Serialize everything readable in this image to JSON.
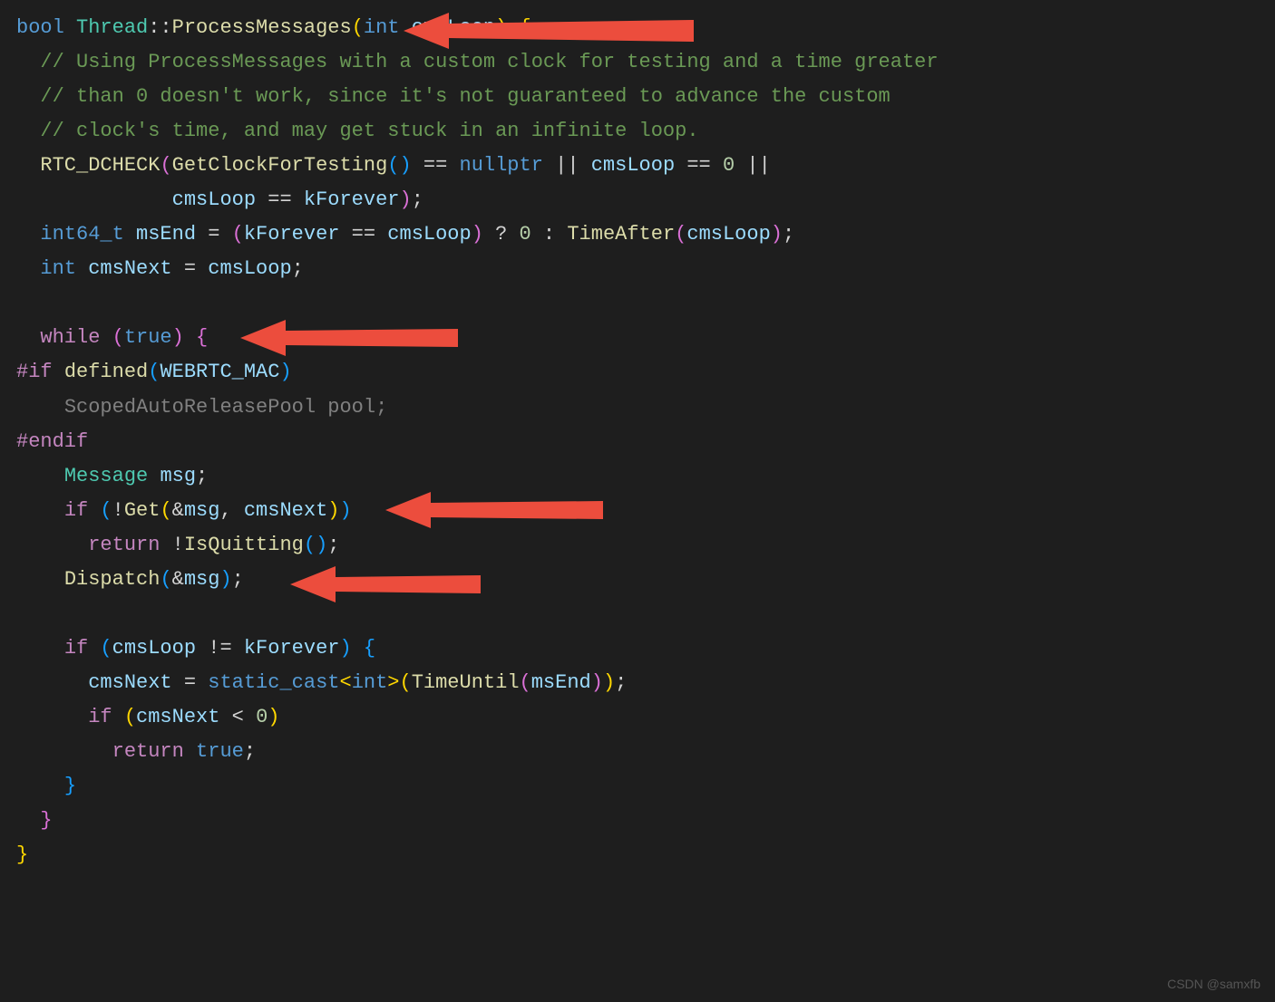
{
  "code": {
    "l1": {
      "t1": "bool",
      "t2": " ",
      "t3": "Thread",
      "t4": "::",
      "t5": "ProcessMessages",
      "t6": "(",
      "t7": "int",
      "t8": " cmsLoop",
      "t9": ")",
      "t10": " {",
      "t11": ""
    },
    "l2": {
      "t1": "  ",
      "t2": "// Using ProcessMessages with a custom clock for testing and a time greater"
    },
    "l3": {
      "t1": "  ",
      "t2": "// than 0 doesn't work, since it's not guaranteed to advance the custom"
    },
    "l4": {
      "t1": "  ",
      "t2": "// clock's time, and may get stuck in an infinite loop."
    },
    "l5": {
      "t1": "  ",
      "t2": "RTC_DCHECK",
      "t3": "(",
      "t4": "GetClockForTesting",
      "t5": "()",
      "t6": " == ",
      "t7": "nullptr",
      "t8": " || ",
      "t9": "cmsLoop",
      "t10": " == ",
      "t11": "0",
      "t12": " ||"
    },
    "l6": {
      "t1": "             ",
      "t2": "cmsLoop",
      "t3": " == ",
      "t4": "kForever",
      "t5": ")",
      "t6": ";"
    },
    "l7": {
      "t1": "  ",
      "t2": "int64_t",
      "t3": " ",
      "t4": "msEnd",
      "t5": " = ",
      "t6": "(",
      "t7": "kForever",
      "t8": " == ",
      "t9": "cmsLoop",
      "t10": ")",
      "t11": " ? ",
      "t12": "0",
      "t13": " : ",
      "t14": "TimeAfter",
      "t15": "(",
      "t16": "cmsLoop",
      "t17": ")",
      "t18": ";"
    },
    "l8": {
      "t1": "  ",
      "t2": "int",
      "t3": " ",
      "t4": "cmsNext",
      "t5": " = ",
      "t6": "cmsLoop",
      "t7": ";"
    },
    "l9": {
      "t1": " "
    },
    "l10": {
      "t1": "  ",
      "t2": "while",
      "t3": " ",
      "t4": "(",
      "t5": "true",
      "t6": ")",
      "t7": " ",
      "t8": "{"
    },
    "l11": {
      "t1": "#if",
      "t2": " ",
      "t3": "defined",
      "t4": "(",
      "t5": "WEBRTC_MAC",
      "t6": ")"
    },
    "l12": {
      "t1": "    ",
      "t2": "ScopedAutoReleasePool",
      "t3": " ",
      "t4": "pool",
      "t5": ";"
    },
    "l13": {
      "t1": "#endif"
    },
    "l14": {
      "t1": "    ",
      "t2": "Message",
      "t3": " ",
      "t4": "msg",
      "t5": ";"
    },
    "l15": {
      "t1": "    ",
      "t2": "if",
      "t3": " ",
      "t4": "(",
      "t5": "!",
      "t6": "Get",
      "t7": "(",
      "t8": "&",
      "t9": "msg",
      "t10": ", ",
      "t11": "cmsNext",
      "t12": ")",
      "t13": ")"
    },
    "l16": {
      "t1": "      ",
      "t2": "return",
      "t3": " !",
      "t4": "IsQuitting",
      "t5": "()",
      "t6": ";"
    },
    "l17": {
      "t1": "    ",
      "t2": "Dispatch",
      "t3": "(",
      "t4": "&",
      "t5": "msg",
      "t6": ")",
      "t7": ";"
    },
    "l18": {
      "t1": " "
    },
    "l19": {
      "t1": "    ",
      "t2": "if",
      "t3": " ",
      "t4": "(",
      "t5": "cmsLoop",
      "t6": " != ",
      "t7": "kForever",
      "t8": ")",
      "t9": " ",
      "t10": "{"
    },
    "l20": {
      "t1": "      ",
      "t2": "cmsNext",
      "t3": " = ",
      "t4": "static_cast",
      "t5": "<",
      "t6": "int",
      "t7": ">",
      "t8": "(",
      "t9": "TimeUntil",
      "t10": "(",
      "t11": "msEnd",
      "t12": ")",
      "t13": ")",
      "t14": ";"
    },
    "l21": {
      "t1": "      ",
      "t2": "if",
      "t3": " ",
      "t4": "(",
      "t5": "cmsNext",
      "t6": " < ",
      "t7": "0",
      "t8": ")"
    },
    "l22": {
      "t1": "        ",
      "t2": "return",
      "t3": " ",
      "t4": "true",
      "t5": ";"
    },
    "l23": {
      "t1": "    ",
      "t2": "}"
    },
    "l24": {
      "t1": "  ",
      "t2": "}"
    },
    "l25": {
      "t1": "}"
    }
  },
  "watermark": "CSDN @samxfb"
}
